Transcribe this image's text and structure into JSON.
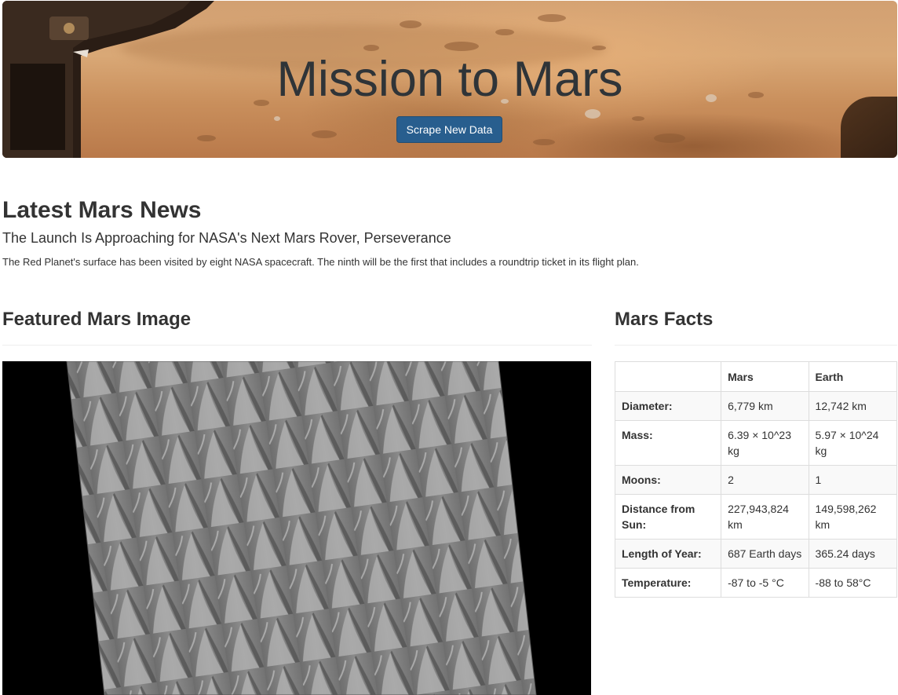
{
  "hero": {
    "title": "Mission to Mars",
    "button_label": "Scrape New Data",
    "button_color": "#285e8e"
  },
  "news": {
    "heading": "Latest Mars News",
    "title": "The Launch Is Approaching for NASA's Next Mars Rover, Perseverance",
    "paragraph": "The Red Planet's surface has been visited by eight NASA spacecraft. The ninth will be the first that includes a roundtrip ticket in its flight plan."
  },
  "featured": {
    "heading": "Featured Mars Image"
  },
  "facts": {
    "heading": "Mars Facts",
    "columns": [
      "",
      "Mars",
      "Earth"
    ],
    "rows": [
      {
        "label": "Diameter:",
        "mars": "6,779 km",
        "earth": "12,742 km"
      },
      {
        "label": "Mass:",
        "mars": "6.39 × 10^23 kg",
        "earth": "5.97 × 10^24 kg"
      },
      {
        "label": "Moons:",
        "mars": "2",
        "earth": "1"
      },
      {
        "label": "Distance from Sun:",
        "mars": "227,943,824 km",
        "earth": "149,598,262 km"
      },
      {
        "label": "Length of Year:",
        "mars": "687 Earth days",
        "earth": "365.24 days"
      },
      {
        "label": "Temperature:",
        "mars": "-87 to -5 °C",
        "earth": "-88 to 58°C"
      }
    ]
  }
}
